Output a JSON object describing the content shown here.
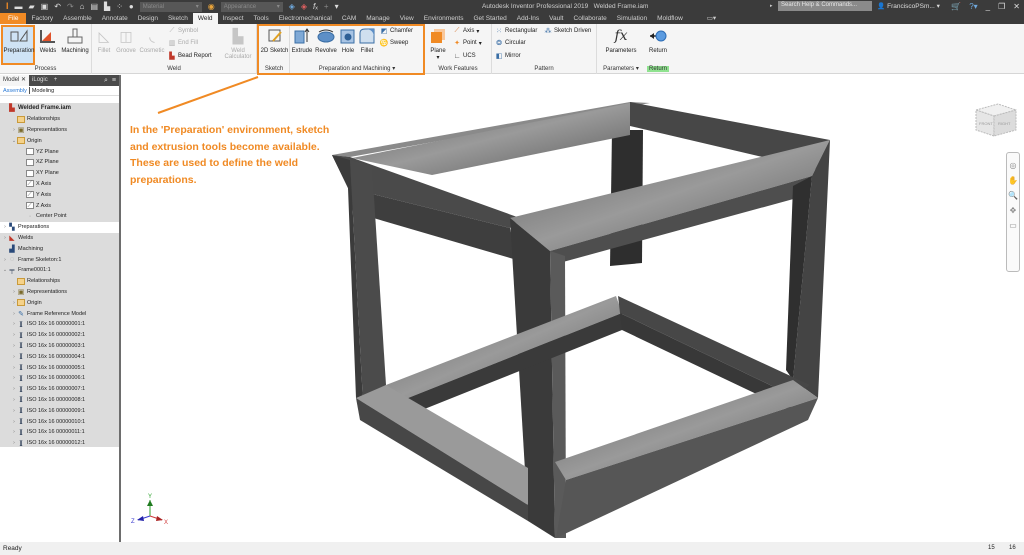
{
  "window": {
    "app_title": "Autodesk Inventor Professional 2019",
    "document_title": "Welded Frame.iam",
    "material_combo": "Material",
    "appearance_combo": "Appearance",
    "search_placeholder": "Search Help & Commands...",
    "user": "FranciscoPSm...",
    "icons": [
      "inventor-logo",
      "new-icon",
      "open-icon",
      "save-icon",
      "undo-icon",
      "redo-icon",
      "home-icon",
      "update-icon",
      "select-icon",
      "measure-icon",
      "color-icon",
      "fx-icon",
      "plus-icon",
      "cart-icon",
      "help-icon",
      "minimize-icon",
      "restore-icon",
      "close-icon"
    ]
  },
  "tabs": [
    {
      "label": "File"
    },
    {
      "label": "Factory"
    },
    {
      "label": "Assemble"
    },
    {
      "label": "Annotate"
    },
    {
      "label": "Design"
    },
    {
      "label": "Sketch"
    },
    {
      "label": "Weld",
      "active": true
    },
    {
      "label": "Inspect"
    },
    {
      "label": "Tools"
    },
    {
      "label": "Electromechanical"
    },
    {
      "label": "CAM"
    },
    {
      "label": "Manage"
    },
    {
      "label": "View"
    },
    {
      "label": "Environments"
    },
    {
      "label": "Get Started"
    },
    {
      "label": "Add-Ins"
    },
    {
      "label": "Vault"
    },
    {
      "label": "Collaborate"
    },
    {
      "label": "Simulation"
    },
    {
      "label": "Moldflow"
    }
  ],
  "ribbon": {
    "process": {
      "title": "Process",
      "preparation": "Preparation",
      "welds": "Welds",
      "machining": "Machining"
    },
    "weld": {
      "title": "Weld",
      "fillet": "Fillet",
      "groove": "Groove",
      "cosmetic": "Cosmetic",
      "symbol": "Symbol",
      "end_fill": "End Fill",
      "bead_report": "Bead Report",
      "weld_calculator_1": "Weld",
      "weld_calculator_2": "Calculator"
    },
    "sketch": {
      "title": "Sketch",
      "sketch_2d": "2D Sketch"
    },
    "prep_machining": {
      "title": "Preparation and Machining",
      "extrude": "Extrude",
      "revolve": "Revolve",
      "hole": "Hole",
      "fillet": "Fillet",
      "chamfer": "Chamfer",
      "sweep": "Sweep"
    },
    "work_features": {
      "title": "Work Features",
      "plane": "Plane",
      "axis": "Axis",
      "point": "Point",
      "ucs": "UCS"
    },
    "pattern": {
      "title": "Pattern",
      "rectangular": "Rectangular",
      "sketch_driven": "Sketch Driven",
      "circular": "Circular",
      "mirror": "Mirror"
    },
    "parameters": {
      "title": "Parameters",
      "parameters": "Parameters"
    },
    "return": {
      "title": "Return",
      "return": "Return"
    }
  },
  "browser": {
    "tab_model": "Model",
    "tab_ilogic": "iLogic",
    "sub_assembly": "Assembly",
    "sub_modeling": "Modeling",
    "tree": [
      {
        "label": "Welded Frame.iam",
        "icon": "assembly",
        "level": 0,
        "bold": true
      },
      {
        "label": "Relationships",
        "icon": "folder",
        "level": 1
      },
      {
        "label": "Representations",
        "icon": "representations",
        "level": 1,
        "expandable": true
      },
      {
        "label": "Origin",
        "icon": "folder-open",
        "level": 1,
        "expanded": true
      },
      {
        "label": "YZ Plane",
        "icon": "plane",
        "level": 2
      },
      {
        "label": "XZ Plane",
        "icon": "plane",
        "level": 2
      },
      {
        "label": "XY Plane",
        "icon": "plane",
        "level": 2
      },
      {
        "label": "X Axis",
        "icon": "axis",
        "level": 2
      },
      {
        "label": "Y Axis",
        "icon": "axis",
        "level": 2
      },
      {
        "label": "Z Axis",
        "icon": "axis",
        "level": 2
      },
      {
        "label": "Center Point",
        "icon": "point",
        "level": 2
      },
      {
        "label": "Preparations",
        "icon": "preparations",
        "level": 0,
        "expandable": true,
        "highlight": true
      },
      {
        "label": "Welds",
        "icon": "welds",
        "level": 0,
        "expandable": true
      },
      {
        "label": "Machining",
        "icon": "machining",
        "level": 0
      },
      {
        "label": "Frame Skeleton:1",
        "icon": "part",
        "level": 0,
        "expandable": true
      },
      {
        "label": "Frame0001:1",
        "icon": "frame",
        "level": 0,
        "expanded": true
      },
      {
        "label": "Relationships",
        "icon": "folder",
        "level": 1
      },
      {
        "label": "Representations",
        "icon": "representations",
        "level": 1,
        "expandable": true
      },
      {
        "label": "Origin",
        "icon": "folder",
        "level": 1,
        "expandable": true
      },
      {
        "label": "Frame Reference Model",
        "icon": "reference",
        "level": 1,
        "expandable": true
      },
      {
        "label": "ISO 16x 16 00000001:1",
        "icon": "ibeam",
        "level": 1,
        "expandable": true
      },
      {
        "label": "ISO 16x 16 00000002:1",
        "icon": "ibeam",
        "level": 1,
        "expandable": true
      },
      {
        "label": "ISO 16x 16 00000003:1",
        "icon": "ibeam",
        "level": 1,
        "expandable": true
      },
      {
        "label": "ISO 16x 16 00000004:1",
        "icon": "ibeam",
        "level": 1,
        "expandable": true
      },
      {
        "label": "ISO 16x 16 00000005:1",
        "icon": "ibeam",
        "level": 1,
        "expandable": true
      },
      {
        "label": "ISO 16x 16 00000006:1",
        "icon": "ibeam",
        "level": 1,
        "expandable": true
      },
      {
        "label": "ISO 16x 16 00000007:1",
        "icon": "ibeam",
        "level": 1,
        "expandable": true
      },
      {
        "label": "ISO 16x 16 00000008:1",
        "icon": "ibeam",
        "level": 1,
        "expandable": true
      },
      {
        "label": "ISO 16x 16 00000009:1",
        "icon": "ibeam",
        "level": 1,
        "expandable": true
      },
      {
        "label": "ISO 16x 16 00000010:1",
        "icon": "ibeam",
        "level": 1,
        "expandable": true
      },
      {
        "label": "ISO 16x 16 00000011:1",
        "icon": "ibeam",
        "level": 1,
        "expandable": true
      },
      {
        "label": "ISO 16x 16 00000012:1",
        "icon": "ibeam",
        "level": 1,
        "expandable": true
      }
    ]
  },
  "viewport": {
    "annotation": "In the 'Preparation' environment, sketch and extrusion tools become available. These are used to define the weld preparations.",
    "viewcube_front": "FRONT",
    "viewcube_right": "RIGHT",
    "viewcube_top": "TOP",
    "triad": {
      "x": "X",
      "y": "Y",
      "z": "Z"
    },
    "accent_color": "#f08a24"
  },
  "status": {
    "text": "Ready",
    "count_a": "15",
    "count_b": "16"
  }
}
